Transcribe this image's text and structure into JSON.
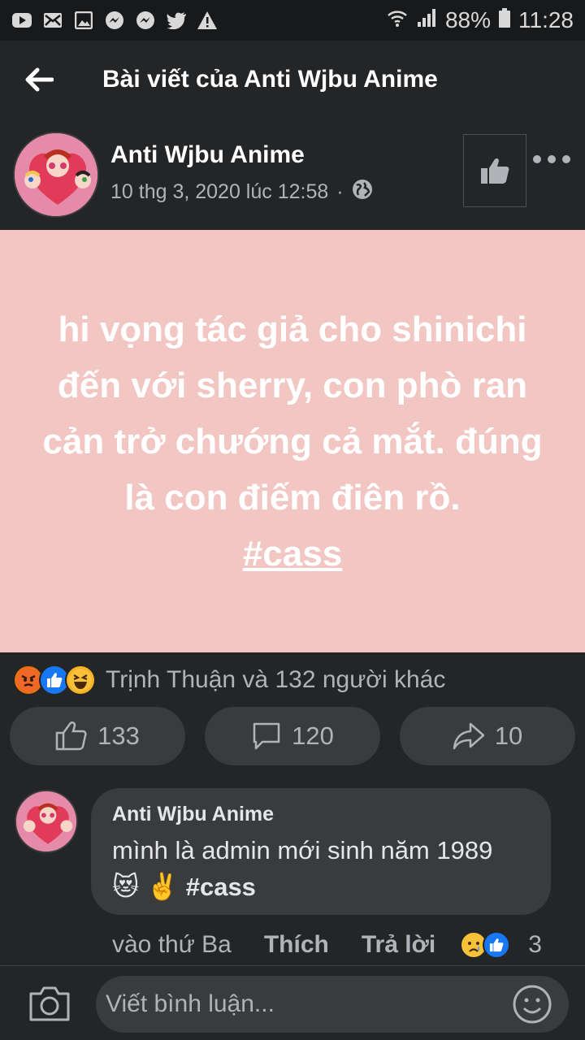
{
  "statusbar": {
    "battery": "88%",
    "time": "11:28",
    "notification_icons": [
      "youtube-icon",
      "mail-icon",
      "gallery-icon",
      "messenger-icon",
      "messenger-icon",
      "twitter-icon",
      "warning-icon"
    ]
  },
  "appbar": {
    "title": "Bài viết của Anti Wjbu Anime"
  },
  "post": {
    "author": "Anti Wjbu Anime",
    "timestamp": "10 thg 3, 2020 lúc 12:58",
    "separator": "·",
    "text_lines": [
      "hi vọng tác giả cho shinichi",
      "đến với sherry, con phò ran",
      "cản trở chướng cả mắt. đúng",
      "là con điếm điên rồ."
    ],
    "hashtag": "#cass",
    "card_color": "#f2c6c3"
  },
  "reactions": {
    "summary": "Trịnh Thuận và 132 người khác"
  },
  "actions": {
    "like_count": "133",
    "comment_count": "120",
    "share_count": "10"
  },
  "comment": {
    "author": "Anti Wjbu Anime",
    "text": "mình là admin mới sinh năm 1989",
    "emojis": "😻 ✌️",
    "hashtag": "#cass",
    "time": "vào thứ Ba",
    "like_label": "Thích",
    "reply_label": "Trả lời",
    "reaction_count": "3"
  },
  "composer": {
    "placeholder": "Viết bình luận..."
  },
  "colors": {
    "background": "#242526",
    "bubble": "#3a3b3c",
    "like_blue": "#1877f2"
  }
}
